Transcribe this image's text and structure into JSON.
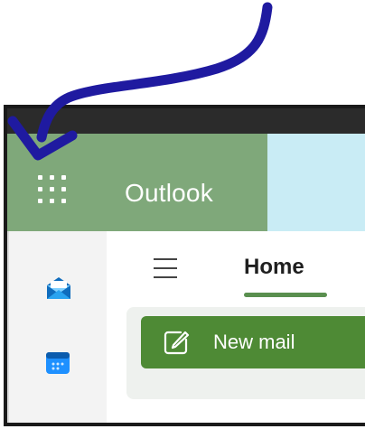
{
  "app": {
    "title": "Outlook"
  },
  "header": {
    "app_launcher_icon": "waffle-grid-icon",
    "accent_green": "#7fa87a",
    "accent_blue": "#c9ecf5"
  },
  "rail": {
    "items": [
      {
        "icon": "mail-envelope-icon"
      },
      {
        "icon": "calendar-icon"
      }
    ]
  },
  "ribbon": {
    "menu_icon": "hamburger-menu-icon",
    "tabs": [
      {
        "label": "Home",
        "selected": true
      }
    ]
  },
  "actions": {
    "new_mail_label": "New mail",
    "new_mail_icon": "compose-edit-icon",
    "button_color": "#4e8a35"
  },
  "annotation": {
    "arrow_icon": "curved-arrow-annotation",
    "color": "#1f1aa0"
  }
}
